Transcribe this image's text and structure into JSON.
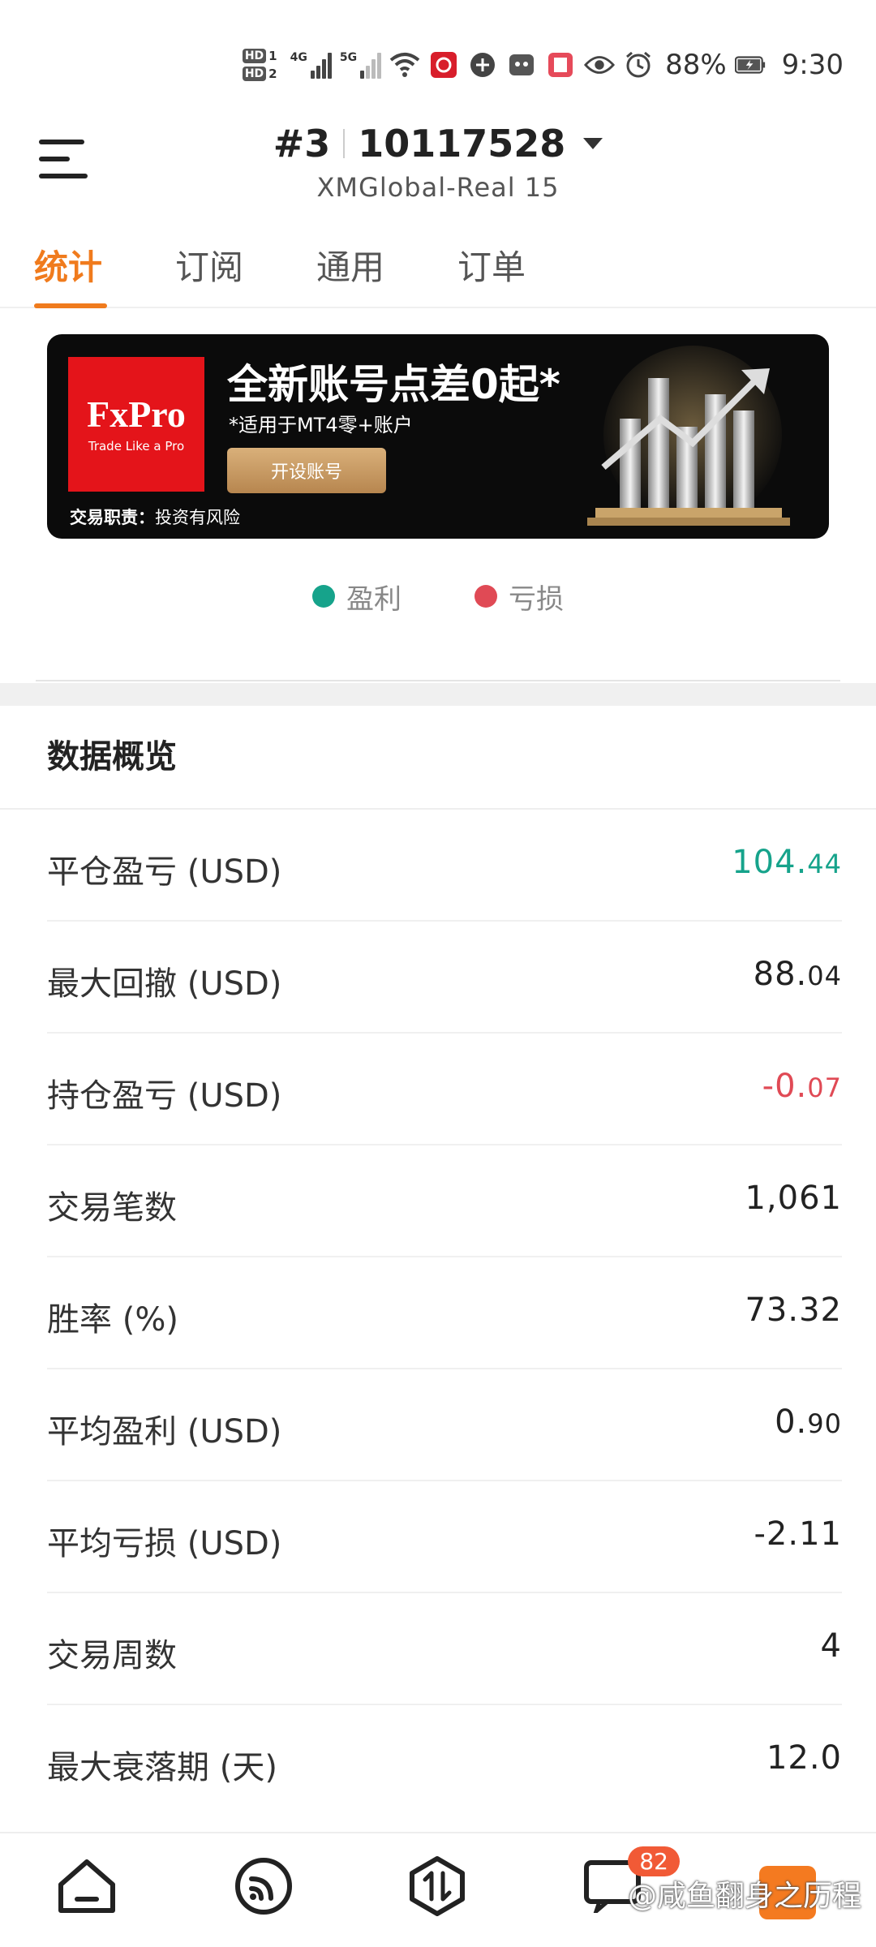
{
  "status_bar": {
    "hd1": "HD",
    "hd1_n": "1",
    "hd2": "HD",
    "hd2_n": "2",
    "net1": "4G",
    "net2": "5G",
    "battery": "88%",
    "time": "9:30"
  },
  "header": {
    "account_index": "#3",
    "account_number": "10117528",
    "server": "XMGlobal-Real 15"
  },
  "tabs": [
    {
      "label": "统计",
      "active": true
    },
    {
      "label": "订阅",
      "active": false
    },
    {
      "label": "通用",
      "active": false
    },
    {
      "label": "订单",
      "active": false
    }
  ],
  "banner": {
    "brand": "FxPro",
    "brand_tagline": "Trade Like a Pro",
    "title": "全新账号点差0起*",
    "subtitle": "*适用于MT4零+账户",
    "button": "开设账号",
    "risk_label": "交易职责：",
    "risk_text": "投资有风险"
  },
  "legend": {
    "profit": "盈利",
    "loss": "亏损",
    "profit_color": "#16a38b",
    "loss_color": "#e04a55"
  },
  "overview": {
    "title": "数据概览",
    "rows": [
      {
        "label": "平仓盈亏 (USD)",
        "value_main": "104.",
        "value_small": "44",
        "tone": "pos"
      },
      {
        "label": "最大回撤 (USD)",
        "value_main": "88.",
        "value_small": "04",
        "tone": "normal"
      },
      {
        "label": "持仓盈亏 (USD)",
        "value_main": "-0.",
        "value_small": "07",
        "tone": "neg"
      },
      {
        "label": "交易笔数",
        "value_main": "1,061",
        "value_small": "",
        "tone": "normal"
      },
      {
        "label": "胜率 (%)",
        "value_main": "73.32",
        "value_small": "",
        "tone": "normal"
      },
      {
        "label": "平均盈利 (USD)",
        "value_main": "0.",
        "value_small": "90",
        "tone": "normal"
      },
      {
        "label": "平均亏损 (USD)",
        "value_main": "-2.11",
        "value_small": "",
        "tone": "normal"
      },
      {
        "label": "交易周数",
        "value_main": "4",
        "value_small": "",
        "tone": "normal"
      },
      {
        "label": "最大衰落期 (天)",
        "value_main": "12.0",
        "value_small": "",
        "tone": "normal"
      }
    ]
  },
  "bottom_nav": {
    "items": [
      "home-icon",
      "feed-icon",
      "trade-icon",
      "messages-icon"
    ],
    "messages_badge": "82",
    "watermark": "@咸鱼翻身之历程"
  }
}
